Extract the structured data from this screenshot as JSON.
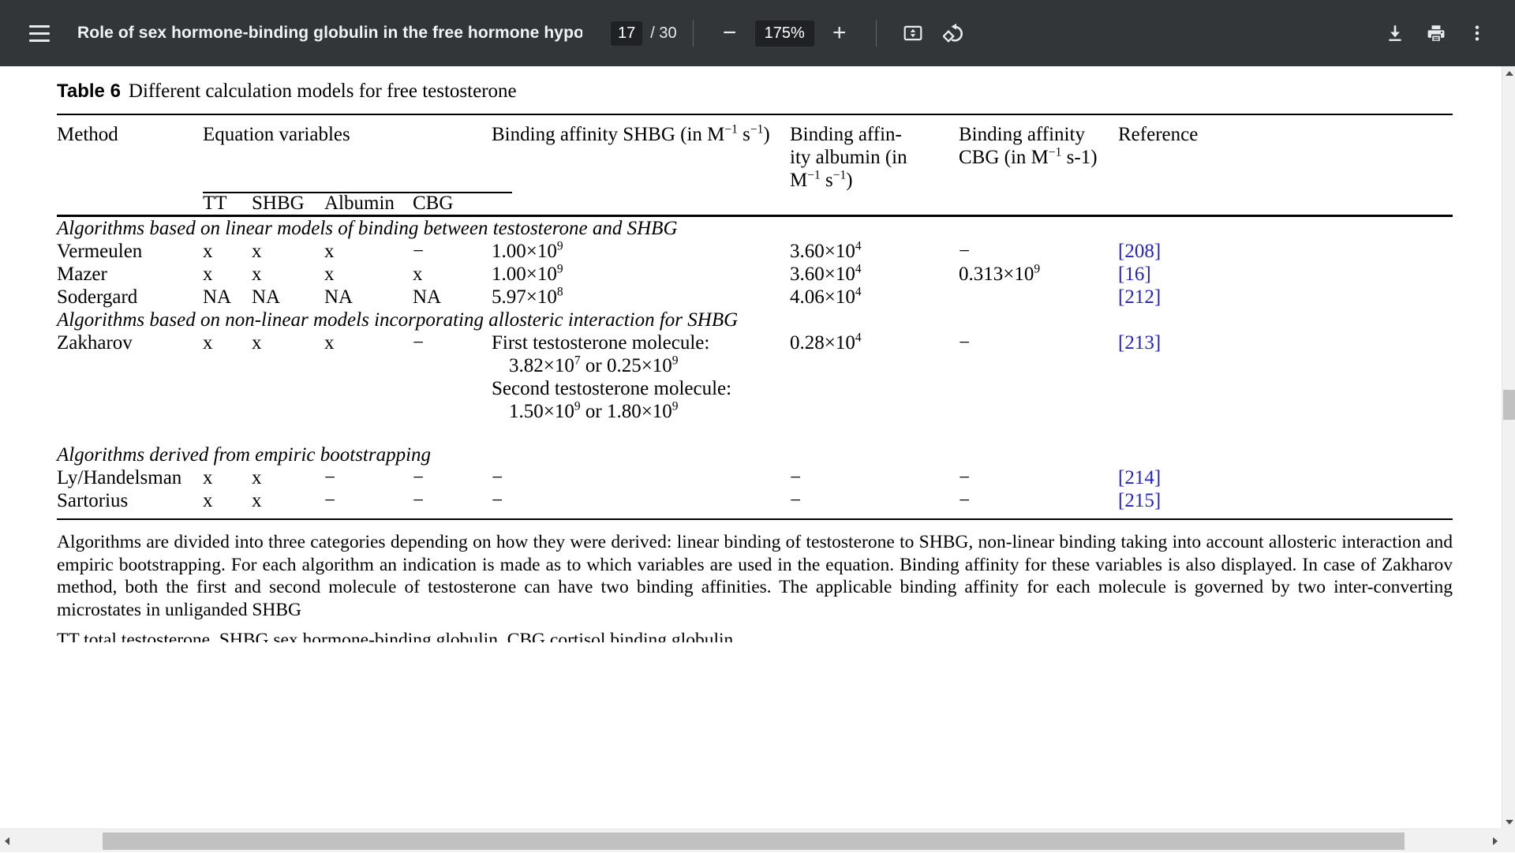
{
  "toolbar": {
    "menu_icon": "hamburger-menu-icon",
    "document_title": "Role of sex hormone-binding globulin in the free hormone hypo…",
    "page_current": "17",
    "page_total": "/ 30",
    "zoom_out_label": "−",
    "zoom_level": "175%",
    "zoom_in_label": "+",
    "fit_icon": "fit-to-page-icon",
    "rotate_icon": "rotate-icon",
    "download_icon": "download-icon",
    "print_icon": "print-icon",
    "more_icon": "more-options-icon"
  },
  "document": {
    "caption_label": "Table 6",
    "caption_text": "Different calculation models for free testosterone",
    "headers": {
      "method": "Method",
      "equation_variables": "Equation variables",
      "affinity_shbg": "Binding affinity SHBG (in M",
      "affinity_shbg_sup1": "−1",
      "affinity_shbg_mid": " s",
      "affinity_shbg_sup2": "−1",
      "affinity_shbg_end": ")",
      "affinity_albumin_l1": "Binding affin-",
      "affinity_albumin_l2": "ity albumin (in",
      "affinity_albumin_l3a": "M",
      "affinity_albumin_sup1": "−1",
      "affinity_albumin_l3b": " s",
      "affinity_albumin_sup2": "−1",
      "affinity_albumin_l3c": ")",
      "affinity_cbg_l1": "Binding affinity",
      "affinity_cbg_l2a": "CBG (in M",
      "affinity_cbg_sup": "−1",
      "affinity_cbg_l2b": " s-1)",
      "reference": "Reference",
      "sub_tt": "TT",
      "sub_shbg": "SHBG",
      "sub_albumin": "Albumin",
      "sub_cbg": "CBG"
    },
    "sections": [
      {
        "title": "Algorithms based on linear models of binding between testosterone and SHBG",
        "rows": [
          {
            "method": "Vermeulen",
            "tt": "x",
            "shbg": "x",
            "albumin": "x",
            "cbg": "−",
            "aff_shbg_mantissa": "1.00",
            "aff_shbg_base": "10",
            "aff_shbg_exp": "9",
            "aff_alb_mantissa": "3.60",
            "aff_alb_base": "10",
            "aff_alb_exp": "4",
            "aff_cbg_plain": "−",
            "reference": "[208]"
          },
          {
            "method": "Mazer",
            "tt": "x",
            "shbg": "x",
            "albumin": "x",
            "cbg": "x",
            "aff_shbg_mantissa": "1.00",
            "aff_shbg_base": "10",
            "aff_shbg_exp": "9",
            "aff_alb_mantissa": "3.60",
            "aff_alb_base": "10",
            "aff_alb_exp": "4",
            "aff_cbg_mantissa": "0.313",
            "aff_cbg_base": "10",
            "aff_cbg_exp": "9",
            "reference": "[16]"
          },
          {
            "method": "Sodergard",
            "tt": "NA",
            "shbg": "NA",
            "albumin": "NA",
            "cbg": "NA",
            "aff_shbg_mantissa": "5.97",
            "aff_shbg_base": "10",
            "aff_shbg_exp": "8",
            "aff_alb_mantissa": "4.06",
            "aff_alb_base": "10",
            "aff_alb_exp": "4",
            "aff_cbg_plain": "",
            "reference": "[212]"
          }
        ]
      },
      {
        "title": "Algorithms based on non-linear models incorporating allosteric interaction for SHBG",
        "rows": [
          {
            "method": "Zakharov",
            "tt": "x",
            "shbg": "x",
            "albumin": "x",
            "cbg": "−",
            "zak_line1": "First testosterone molecule:",
            "zak_line2_a": "3.82",
            "zak_line2_base1": "10",
            "zak_line2_exp1": "7",
            "zak_line2_or": "or",
            "zak_line2_b": "0.25",
            "zak_line2_base2": "10",
            "zak_line2_exp2": "9",
            "zak_line3": "Second testosterone molecule:",
            "zak_line4_a": "1.50",
            "zak_line4_base1": "10",
            "zak_line4_exp1": "9",
            "zak_line4_or": "or",
            "zak_line4_b": "1.80",
            "zak_line4_base2": "10",
            "zak_line4_exp2": "9",
            "aff_alb_mantissa": "0.28",
            "aff_alb_base": "10",
            "aff_alb_exp": "4",
            "aff_cbg_plain": "−",
            "reference": "[213]"
          }
        ]
      },
      {
        "title": "Algorithms derived from empiric bootstrapping",
        "rows": [
          {
            "method": "Ly/Handelsman",
            "tt": "x",
            "shbg": "x",
            "albumin": "−",
            "cbg": "−",
            "aff_shbg_plain": "−",
            "aff_alb_plain": "−",
            "aff_cbg_plain": "−",
            "reference": "[214]"
          },
          {
            "method": "Sartorius",
            "tt": "x",
            "shbg": "x",
            "albumin": "−",
            "cbg": "−",
            "aff_shbg_plain": "−",
            "aff_alb_plain": "−",
            "aff_cbg_plain": "−",
            "reference": "[215]"
          }
        ]
      }
    ],
    "footnote": "Algorithms are divided into three categories depending on how they were derived: linear binding of testosterone to SHBG, non-linear binding taking into account allosteric interaction and empiric bootstrapping. For each algorithm an indication is made as to which variables are used in the equation. Binding affinity for these variables is also displayed. In case of Zakharov method, both the first and second molecule of testosterone can have two binding affinities. The applicable binding affinity for each molecule is governed by two inter-converting microstates in unliganded SHBG",
    "footnote_next": "TT total testosterone, SHBG sex hormone-binding globulin, CBG cortisol binding globulin"
  },
  "colors": {
    "toolbar_bg": "#323639",
    "reference_link": "#2222cc",
    "page_bg": "#ffffff",
    "scrollbar_thumb": "#c1c1c1"
  }
}
